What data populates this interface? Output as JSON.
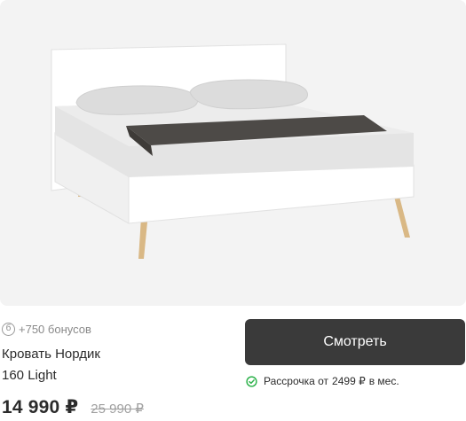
{
  "product": {
    "bonus_text": "+750 бонусов",
    "bonus_icon": "bonus-coin-icon",
    "title_line1": "Кровать Нордик",
    "title_line2": "160 Light",
    "price": "14 990 ₽",
    "old_price": "25 990 ₽"
  },
  "actions": {
    "view_label": "Смотреть"
  },
  "installment": {
    "prefix": "Рассрочка от",
    "amount": "2499 ₽",
    "suffix": "в мес.",
    "icon": "check-circle-icon",
    "icon_color": "#2fb24c"
  },
  "colors": {
    "button_bg": "#3a3a3a",
    "image_bg": "#f3f3f3"
  }
}
